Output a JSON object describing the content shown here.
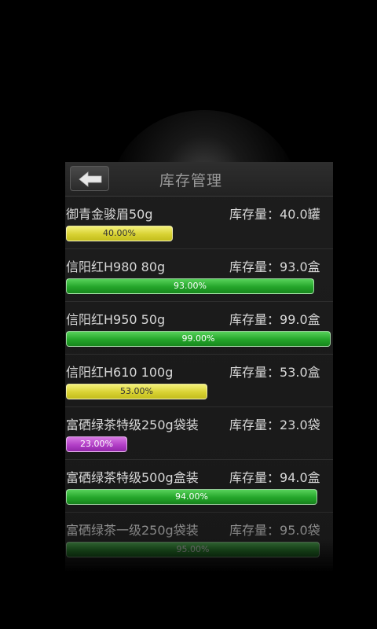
{
  "header": {
    "title": "库存管理",
    "back_icon": "arrow-left-icon"
  },
  "items": [
    {
      "name": "御青金骏眉50g",
      "stock_label": "库存量：",
      "stock": "40.0罐",
      "percent": 40,
      "percent_text": "40.00%",
      "color": "yellow"
    },
    {
      "name": "信阳红H980 80g",
      "stock_label": "库存量：",
      "stock": "93.0盒",
      "percent": 93,
      "percent_text": "93.00%",
      "color": "green"
    },
    {
      "name": "信阳红H950 50g",
      "stock_label": "库存量：",
      "stock": "99.0盒",
      "percent": 99,
      "percent_text": "99.00%",
      "color": "green"
    },
    {
      "name": "信阳红H610 100g",
      "stock_label": "库存量：",
      "stock": "53.0盒",
      "percent": 53,
      "percent_text": "53.00%",
      "color": "yellow"
    },
    {
      "name": "富硒绿茶特级250g袋装",
      "stock_label": "库存量：",
      "stock": "23.0袋",
      "percent": 23,
      "percent_text": "23.00%",
      "color": "purple"
    },
    {
      "name": "富硒绿茶特级500g盒装",
      "stock_label": "库存量：",
      "stock": "94.0盒",
      "percent": 94,
      "percent_text": "94.00%",
      "color": "green"
    },
    {
      "name": "富硒绿茶一级250g袋装",
      "stock_label": "库存量：",
      "stock": "95.0袋",
      "percent": 95,
      "percent_text": "95.00%",
      "color": "green"
    }
  ]
}
